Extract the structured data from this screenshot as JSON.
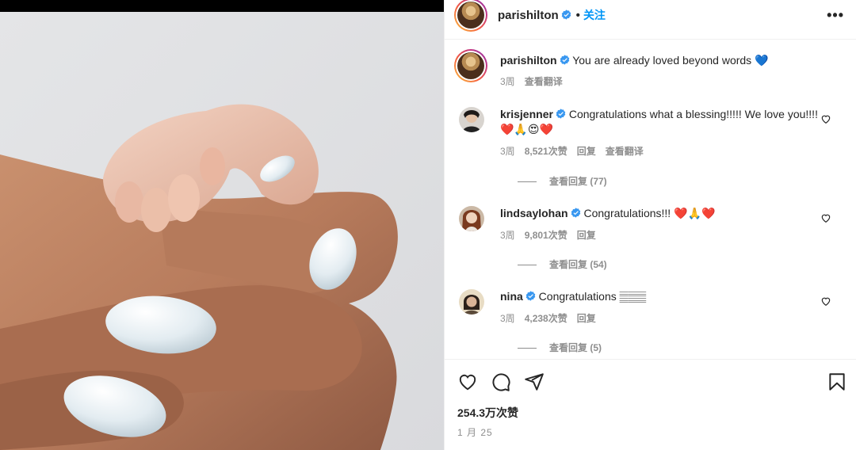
{
  "post": {
    "author": "parishilton",
    "follow_label": "关注",
    "separator": "•",
    "more_label": "•••"
  },
  "caption": {
    "user": "parishilton",
    "text": "You are already loved beyond words 💙",
    "time": "3周",
    "translate_label": "查看翻译"
  },
  "comments": [
    {
      "user": "krisjenner",
      "text": "Congratulations what a blessing!!!!! We love you!!!! ❤️🙏😍❤️",
      "time": "3周",
      "likes": "8,521次赞",
      "reply_label": "回复",
      "translate_label": "查看翻译",
      "view_replies": "查看回复 (77)"
    },
    {
      "user": "lindsaylohan",
      "text": "Congratulations!!! ❤️🙏❤️",
      "time": "3周",
      "likes": "9,801次赞",
      "reply_label": "回复",
      "view_replies": "查看回复 (54)"
    },
    {
      "user": "nina",
      "text": "Congratulations 𝄛𝄛𝄛",
      "time": "3周",
      "likes": "4,238次赞",
      "reply_label": "回复",
      "view_replies": "查看回复 (5)"
    }
  ],
  "footer": {
    "like_count": "254.3万次赞",
    "date": "1 月 25"
  },
  "icons": [
    "verified-badge-icon",
    "heart-icon",
    "comment-icon",
    "share-icon",
    "bookmark-icon",
    "more-icon"
  ],
  "colors": {
    "accent": "#0095f6",
    "verified": "#3897f0",
    "muted": "#8e8e8e",
    "text": "#262626"
  }
}
